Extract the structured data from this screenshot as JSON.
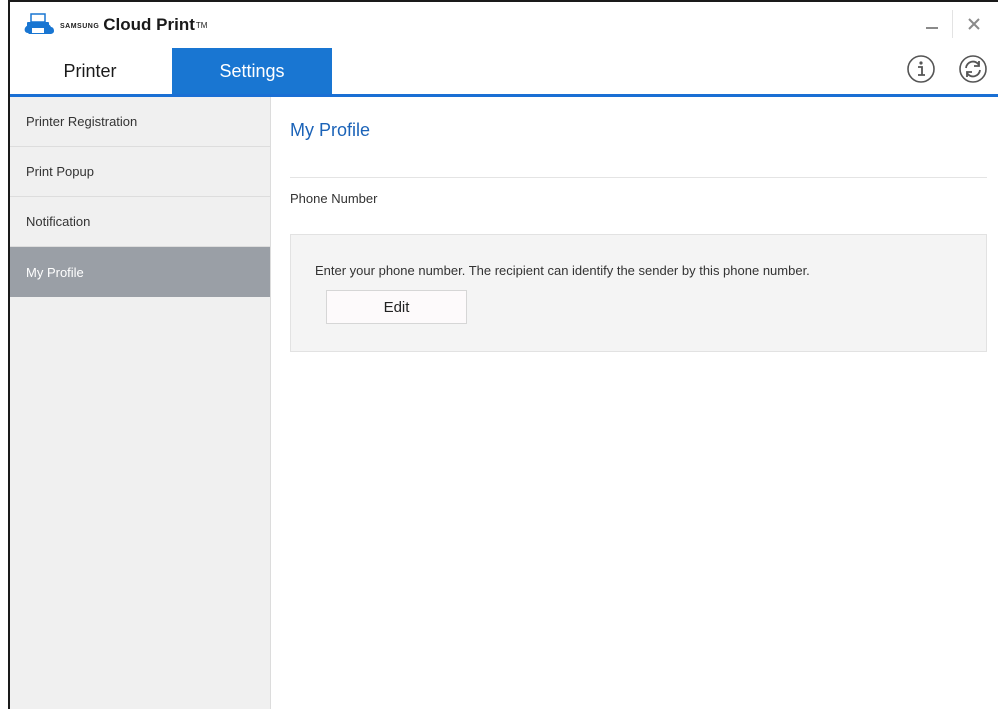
{
  "app": {
    "brand_small": "SAMSUNG",
    "brand_name": "Cloud Print",
    "brand_tm": "TM"
  },
  "window_controls": {
    "minimize_icon": "minimize-icon",
    "close_icon": "close-icon"
  },
  "tabs": [
    {
      "label": "Printer",
      "active": false
    },
    {
      "label": "Settings",
      "active": true
    }
  ],
  "toolbar_icons": [
    "info-icon",
    "refresh-icon"
  ],
  "sidebar": {
    "items": [
      {
        "label": "Printer Registration",
        "active": false
      },
      {
        "label": "Print Popup",
        "active": false
      },
      {
        "label": "Notification",
        "active": false
      },
      {
        "label": "My Profile",
        "active": true
      }
    ]
  },
  "main": {
    "title": "My Profile",
    "section_label": "Phone Number",
    "description": "Enter your phone number. The recipient can identify the sender by this phone number.",
    "edit_label": "Edit"
  },
  "colors": {
    "accent": "#1976d2",
    "title_blue": "#1b63b8",
    "sidebar_active": "#9a9fa6",
    "sidebar_bg": "#f0f0f0"
  }
}
